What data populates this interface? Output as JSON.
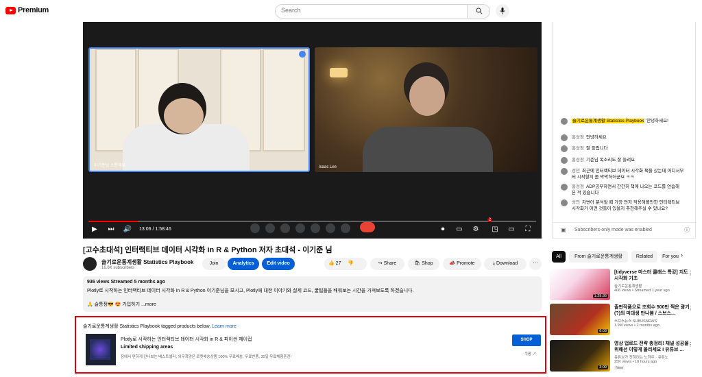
{
  "header": {
    "logo_text": "Premium",
    "search_placeholder": "Search"
  },
  "player": {
    "left_participant": "이기준님 소통해요",
    "right_participant": "Isaac Lee",
    "clock_overlay": "9:42 AM | 이기준님 소통해요",
    "time": "13:06 / 1:58:46",
    "progress": 0.11,
    "notification_count": "2"
  },
  "chat": {
    "messages": [
      {
        "author": "슬기로운통계생활 Statistics Playbook",
        "text": "안녕하세요!",
        "highlight": true
      },
      {
        "author": "홍성정",
        "text": "안녕하세요",
        "highlight": false
      },
      {
        "author": "홍성정",
        "text": "잘 들립니다",
        "highlight": false
      },
      {
        "author": "홍성정",
        "text": "기준님 목소리도 잘 들려요",
        "highlight": false
      },
      {
        "author": "성민",
        "text": "최근에 인터랙티브 데이터 시각화 책을 샀는데 어디서부터 시작할지 좀 막막하더군요 ㅋㅋ",
        "highlight": false
      },
      {
        "author": "홍성정",
        "text": "ADP공부하면서 간간히 책에 나오는 코드를 연습해 본 적 있습니다",
        "highlight": false
      },
      {
        "author": "성민",
        "text": "차변어 분석할 때 가장 먼저 적용해볼만한 인터랙티브 시각화가 어떤 것들이 있을지 추천해주실 수 있나요?",
        "highlight": false
      }
    ],
    "mode_text": "Subscribers-only mode was enabled"
  },
  "video": {
    "title": "[고수초대석] 인터랙티브 데이터 시각화 in R & Python 저자 초대석 - 이기준 님",
    "channel": "슬기로운통계생활 Statistics Playbook",
    "subscribers": "16.6K subscribers",
    "join": "Join",
    "analytics": "Analytics",
    "edit": "Edit video",
    "likes": "27",
    "share": "Share",
    "shop": "Shop",
    "promote": "Promote",
    "download": "Download",
    "more": "⋯"
  },
  "description": {
    "meta": "936 views  Streamed 5 months ago",
    "line1": "Plotly로 시작하는 인터랙티브 데이터 시각화 in R & Python 이기준님을 모시고, Plotly에 대한 이야기와 실제 코드, 꿀팁들을 배워보는 시간을 가져보도록 하겠습니다.",
    "line2": "🙏 슬통쟁😎 😍  가입하기  ...more"
  },
  "products": {
    "header": "슬기로운통계생활 Statistics Playbook tagged products below.",
    "learn_more": "Learn more",
    "title": "Plotly로 시작하는 인터랙티브 데이터 시각화 in R & 파이썬 제이컵",
    "shipping": "Limited shipping areas",
    "note": "잠에서 편하게 만나보는 베스트셀러, 외우최양은 로켓배송상품 100% 무료배송, 무료반품, 30일 무료체험혼진!",
    "shop_button": "SHOP",
    "buy_label": "쿠팡"
  },
  "chips": [
    "All",
    "From 슬기로운통계생활",
    "Related",
    "For you"
  ],
  "recommendations": [
    {
      "title": "[tidyverse 마스터 클래스 특강] 지도 시각화 기초",
      "channel": "슬기로운통계생활",
      "meta": "406 views • Streamed 1 year ago",
      "duration": "1:29:36",
      "badge": ""
    },
    {
      "title": "출판작품으로 조회수 500만 찍은 광기(?)의 미대생 만나봄 / 스브스...",
      "channel": "스브스뉴스 SUBUSNEWS",
      "meta": "1.9M views • 2 months ago",
      "duration": "6:03",
      "badge": ""
    },
    {
      "title": "영상 업로드 전략 총정리! 채널 성공을 위해선 이렇게 올리세요 I 유튜브 ...",
      "channel": "유튜브가 전하려는 노하우 · 유튜노",
      "meta": "25K views • 10 hours ago",
      "duration": "3:09",
      "badge": "New"
    }
  ],
  "colors": {
    "youtube_red": "#ff0000",
    "accent_blue": "#065fd4",
    "highlight_border": "#e0000b"
  }
}
